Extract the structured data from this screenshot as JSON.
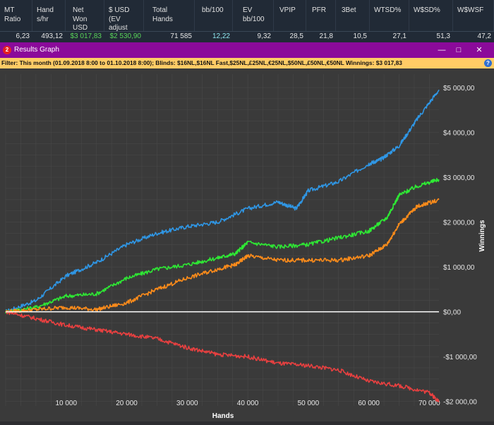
{
  "stats_table": {
    "headers": [
      "MT Ratio",
      "Hand s/hr",
      "Net Won USD",
      "$ USD (EV adjust",
      "Total Hands",
      "bb/100",
      "EV bb/100",
      "VPIP",
      "PFR",
      "3Bet",
      "WTSD%",
      "W$SD%",
      "W$WSF"
    ],
    "values": [
      "6,23",
      "493,12",
      "$3 017,83",
      "$2 530,90",
      "71 585",
      "12,22",
      "9,32",
      "28,5",
      "21,8",
      "10,5",
      "27,1",
      "51,3",
      "47,2"
    ]
  },
  "window": {
    "title": "Results Graph",
    "app_badge": "2",
    "minimize_icon": "minimize-icon",
    "maximize_icon": "maximize-icon",
    "close_icon": "close-icon"
  },
  "filter": {
    "prefix": "Filter: ",
    "text": "This month (01.09.2018 8:00 to 01.10.2018 8:00); Blinds: $16NL,$16NL Fast,$25NL,£25NL,€25NL,$50NL,£50NL,€50NL Winnings: $3 017,83",
    "help_label": "?"
  },
  "colors": {
    "background": "#3a3a3a",
    "grid": "#4a4a4a",
    "zero_line": "#ffffff",
    "net_won": "#2f97e6",
    "showdown": "#2ee834",
    "non_showdown": "#ff8c1a",
    "all_in_ev": "#e84040"
  },
  "chart_data": {
    "type": "line",
    "xlabel": "Hands",
    "ylabel": "Winnings",
    "xlim": [
      0,
      71585
    ],
    "ylim": [
      -2100,
      5300
    ],
    "x_ticks": [
      10000,
      20000,
      30000,
      40000,
      50000,
      60000,
      70000
    ],
    "x_tick_labels": [
      "10 000",
      "20 000",
      "30 000",
      "40 000",
      "50 000",
      "60 000",
      "70 000"
    ],
    "y_ticks": [
      5000,
      4000,
      3000,
      2000,
      1000,
      0,
      -1000,
      -2000
    ],
    "y_tick_labels": [
      "$5 000,00",
      "$4 000,00",
      "$3 000,00",
      "$2 000,00",
      "$1 000,00",
      "$0,00",
      "-$1 000,00",
      "-$2 000,00"
    ],
    "grid": true,
    "series": [
      {
        "color": "#2f97e6",
        "x": [
          0,
          5000,
          10000,
          15000,
          20000,
          25000,
          30000,
          35000,
          40000,
          45000,
          48000,
          50000,
          55000,
          60000,
          62000,
          65000,
          68000,
          71585
        ],
        "y": [
          0,
          250,
          800,
          1100,
          1500,
          1750,
          1900,
          2000,
          2300,
          2450,
          2300,
          2700,
          2900,
          3300,
          3400,
          3700,
          4300,
          4950
        ]
      },
      {
        "color": "#2ee834",
        "x": [
          0,
          5000,
          10000,
          15000,
          20000,
          25000,
          30000,
          35000,
          38000,
          40000,
          45000,
          50000,
          55000,
          60000,
          63000,
          65000,
          68000,
          71585
        ],
        "y": [
          0,
          100,
          350,
          400,
          750,
          950,
          1050,
          1200,
          1300,
          1550,
          1450,
          1500,
          1650,
          1800,
          2100,
          2600,
          2800,
          2950
        ]
      },
      {
        "color": "#ff8c1a",
        "x": [
          0,
          5000,
          10000,
          15000,
          20000,
          25000,
          30000,
          35000,
          38000,
          40000,
          45000,
          50000,
          55000,
          60000,
          63000,
          65000,
          68000,
          71585
        ],
        "y": [
          0,
          50,
          100,
          50,
          200,
          500,
          750,
          950,
          1050,
          1250,
          1150,
          1150,
          1150,
          1250,
          1500,
          1950,
          2350,
          2500
        ]
      },
      {
        "color": "#e84040",
        "x": [
          0,
          5000,
          10000,
          15000,
          20000,
          25000,
          30000,
          35000,
          40000,
          45000,
          50000,
          55000,
          60000,
          65000,
          70000,
          71585
        ],
        "y": [
          0,
          -150,
          -300,
          -400,
          -500,
          -600,
          -800,
          -950,
          -1000,
          -1150,
          -1200,
          -1300,
          -1550,
          -1650,
          -1800,
          -2000
        ]
      }
    ]
  }
}
